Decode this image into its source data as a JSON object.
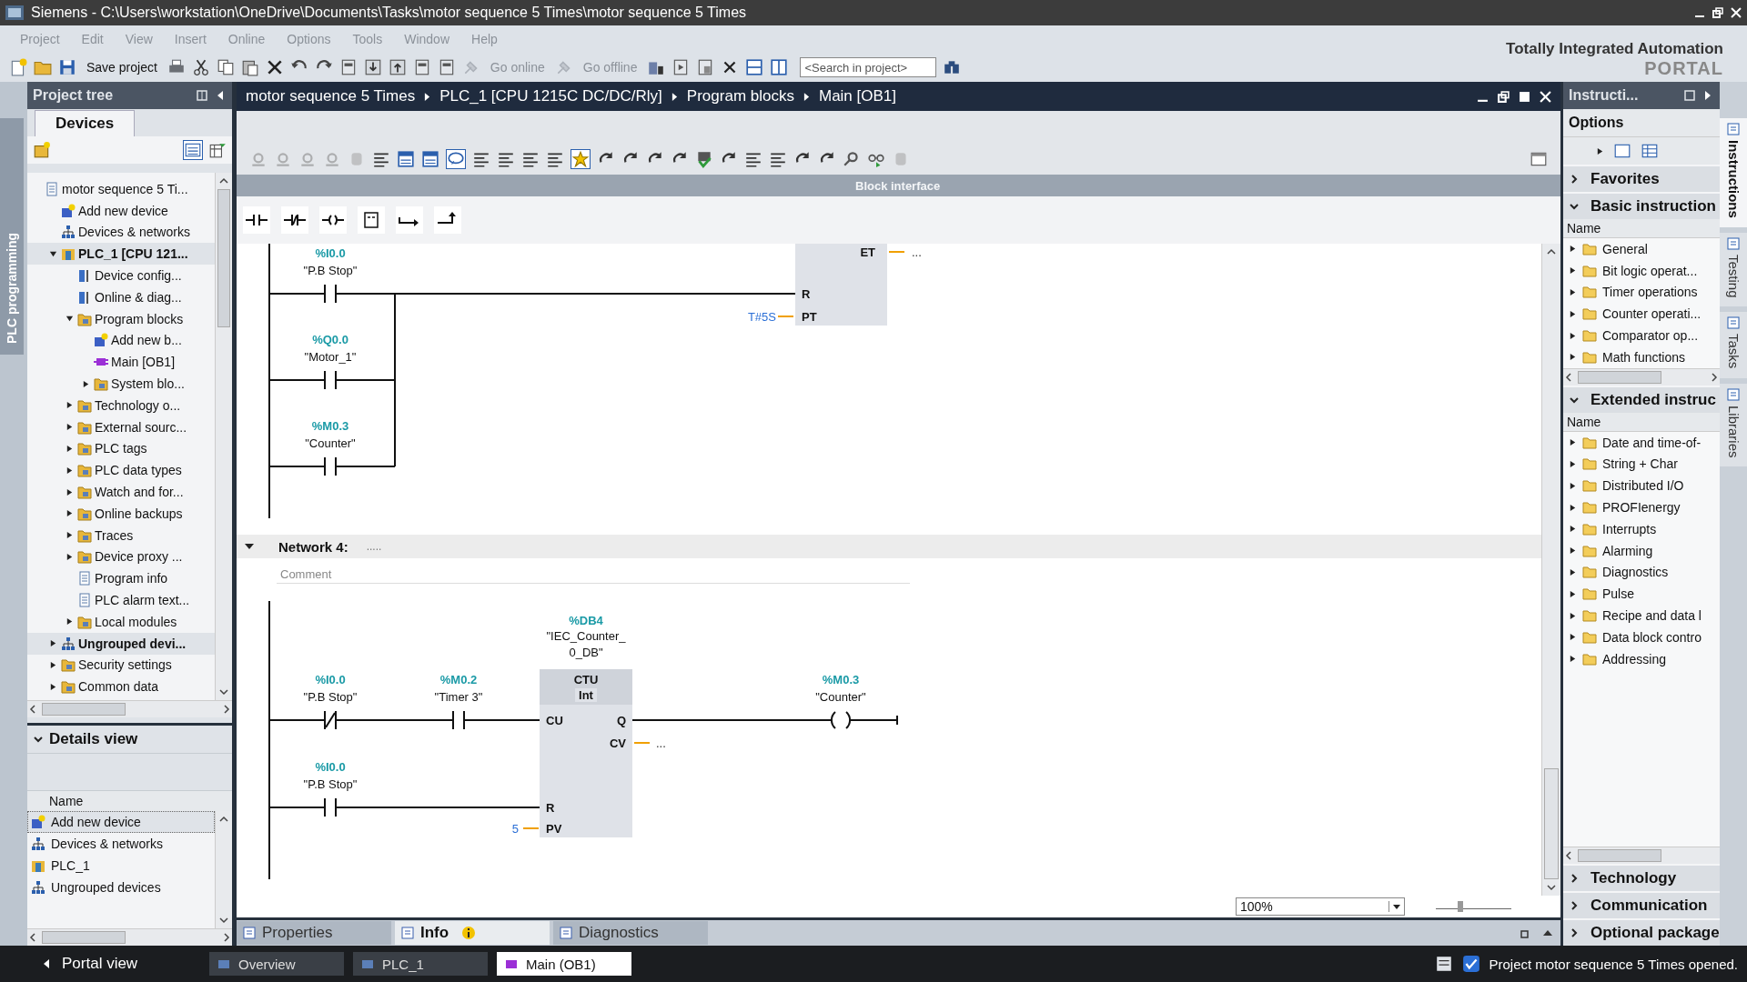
{
  "window": {
    "title": "Siemens  -  C:\\Users\\workstation\\OneDrive\\Documents\\Tasks\\motor sequence 5 Times\\motor sequence 5 Times"
  },
  "menu": [
    "Project",
    "Edit",
    "View",
    "Insert",
    "Online",
    "Options",
    "Tools",
    "Window",
    "Help"
  ],
  "toolbar": {
    "save": "Save project",
    "go_online": "Go online",
    "go_offline": "Go offline",
    "search_placeholder": "<Search in project>"
  },
  "brand": {
    "name": "Totally Integrated Automation",
    "portal": "PORTAL"
  },
  "side_tab": "PLC programming",
  "project_tree": {
    "title": "Project tree",
    "tab": "Devices",
    "items": [
      {
        "label": "motor sequence 5 Ti...",
        "children": [
          {
            "label": "Add new device"
          },
          {
            "label": "Devices & networks"
          },
          {
            "label": "PLC_1 [CPU 121...",
            "bold": true,
            "expanded": true,
            "children": [
              {
                "label": "Device config..."
              },
              {
                "label": "Online & diag..."
              },
              {
                "label": "Program blocks",
                "expanded": true,
                "children": [
                  {
                    "label": "Add new b..."
                  },
                  {
                    "label": "Main [OB1]"
                  },
                  {
                    "label": "System blo...",
                    "expanded": false
                  }
                ]
              },
              {
                "label": "Technology o...",
                "expanded": false
              },
              {
                "label": "External sourc...",
                "expanded": false
              },
              {
                "label": "PLC tags",
                "expanded": false
              },
              {
                "label": "PLC data types",
                "expanded": false
              },
              {
                "label": "Watch and for...",
                "expanded": false
              },
              {
                "label": "Online backups",
                "expanded": false
              },
              {
                "label": "Traces",
                "expanded": false
              },
              {
                "label": "Device proxy ...",
                "expanded": false
              },
              {
                "label": "Program info"
              },
              {
                "label": "PLC alarm text..."
              },
              {
                "label": "Local modules",
                "expanded": false
              }
            ]
          },
          {
            "label": "Ungrouped devi...",
            "bold": true,
            "expanded": false
          },
          {
            "label": "Security settings",
            "expanded": false
          },
          {
            "label": "Common data",
            "expanded": false
          }
        ]
      }
    ]
  },
  "details_view": {
    "title": "Details view",
    "column": "Name",
    "items": [
      {
        "label": "Add new device",
        "selected": true
      },
      {
        "label": "Devices & networks",
        "selected": false
      },
      {
        "label": "PLC_1",
        "selected": false
      },
      {
        "label": "Ungrouped devices",
        "selected": false
      }
    ]
  },
  "editor": {
    "breadcrumb": [
      "motor sequence 5 Times",
      "PLC_1 [CPU 1215C DC/DC/Rly]",
      "Program blocks",
      "Main [OB1]"
    ],
    "block_interface": "Block interface",
    "network_3": {
      "contacts": [
        {
          "kind": "no",
          "address": "%I0.0",
          "tag": "\"P.B Stop\""
        },
        {
          "kind": "no",
          "address": "%Q0.0",
          "tag": "\"Motor_1\""
        },
        {
          "kind": "no",
          "address": "%M0.3",
          "tag": "\"Counter\""
        }
      ],
      "timer_pins": [
        {
          "name": "ET",
          "value": "..."
        },
        {
          "name": "R"
        },
        {
          "name": "PT",
          "value": "T#5S"
        }
      ]
    },
    "network_4": {
      "title": "Network 4:",
      "title_dots": ".....",
      "comment": "Comment",
      "contacts": [
        {
          "kind": "nc",
          "address": "%I0.0",
          "tag": "\"P.B Stop\""
        },
        {
          "kind": "no",
          "address": "%M0.2",
          "tag": "\"Timer 3\""
        },
        {
          "kind": "coil",
          "address": "%M0.3",
          "tag": "\"Counter\""
        },
        {
          "kind": "no",
          "address": "%I0.0",
          "tag": "\"P.B Stop\""
        }
      ],
      "block": {
        "address": "%DB4",
        "instance": "\"IEC_Counter_0_DB\"",
        "type": "CTU",
        "data_type": "Int",
        "pins": [
          {
            "name": "CU"
          },
          {
            "name": "Q"
          },
          {
            "name": "CV",
            "value": "..."
          },
          {
            "name": "R"
          },
          {
            "name": "PV",
            "value": "5"
          }
        ]
      }
    },
    "zoom": {
      "value": "100%",
      "level": 0.33
    }
  },
  "inspector_tabs": [
    {
      "label": "Properties",
      "selected": false
    },
    {
      "label": "Info",
      "selected": true
    },
    {
      "label": "Diagnostics",
      "selected": false
    }
  ],
  "instructions": {
    "title": "Instructi...",
    "options": "Options",
    "sections": [
      {
        "label": "Favorites",
        "expanded": false
      },
      {
        "label": "Basic instruction",
        "expanded": true,
        "column": "Name",
        "items": [
          "General",
          "Bit logic operat...",
          "Timer operations",
          "Counter operati...",
          "Comparator op...",
          "Math functions"
        ]
      },
      {
        "label": "Extended instruc",
        "expanded": true,
        "column": "Name",
        "items": [
          "Date and time-of-",
          "String + Char",
          "Distributed I/O",
          "PROFIenergy",
          "Interrupts",
          "Alarming",
          "Diagnostics",
          "Pulse",
          "Recipe and data l",
          "Data block contro",
          "Addressing"
        ]
      }
    ],
    "more_sections": [
      {
        "label": "Technology",
        "expanded": false
      },
      {
        "label": "Communication",
        "expanded": false
      },
      {
        "label": "Optional package",
        "expanded": false
      }
    ]
  },
  "right_tabs": [
    {
      "label": "Instructions",
      "selected": true
    },
    {
      "label": "Testing",
      "selected": false
    },
    {
      "label": "Tasks",
      "selected": false
    },
    {
      "label": "Libraries",
      "selected": false
    }
  ],
  "bottom_bar": {
    "portal_view": "Portal view",
    "tabs": [
      {
        "label": "Overview",
        "selected": false
      },
      {
        "label": "PLC_1",
        "selected": false
      },
      {
        "label": "Main (OB1)",
        "selected": true
      }
    ],
    "status": "Project motor sequence 5 Times opened."
  }
}
